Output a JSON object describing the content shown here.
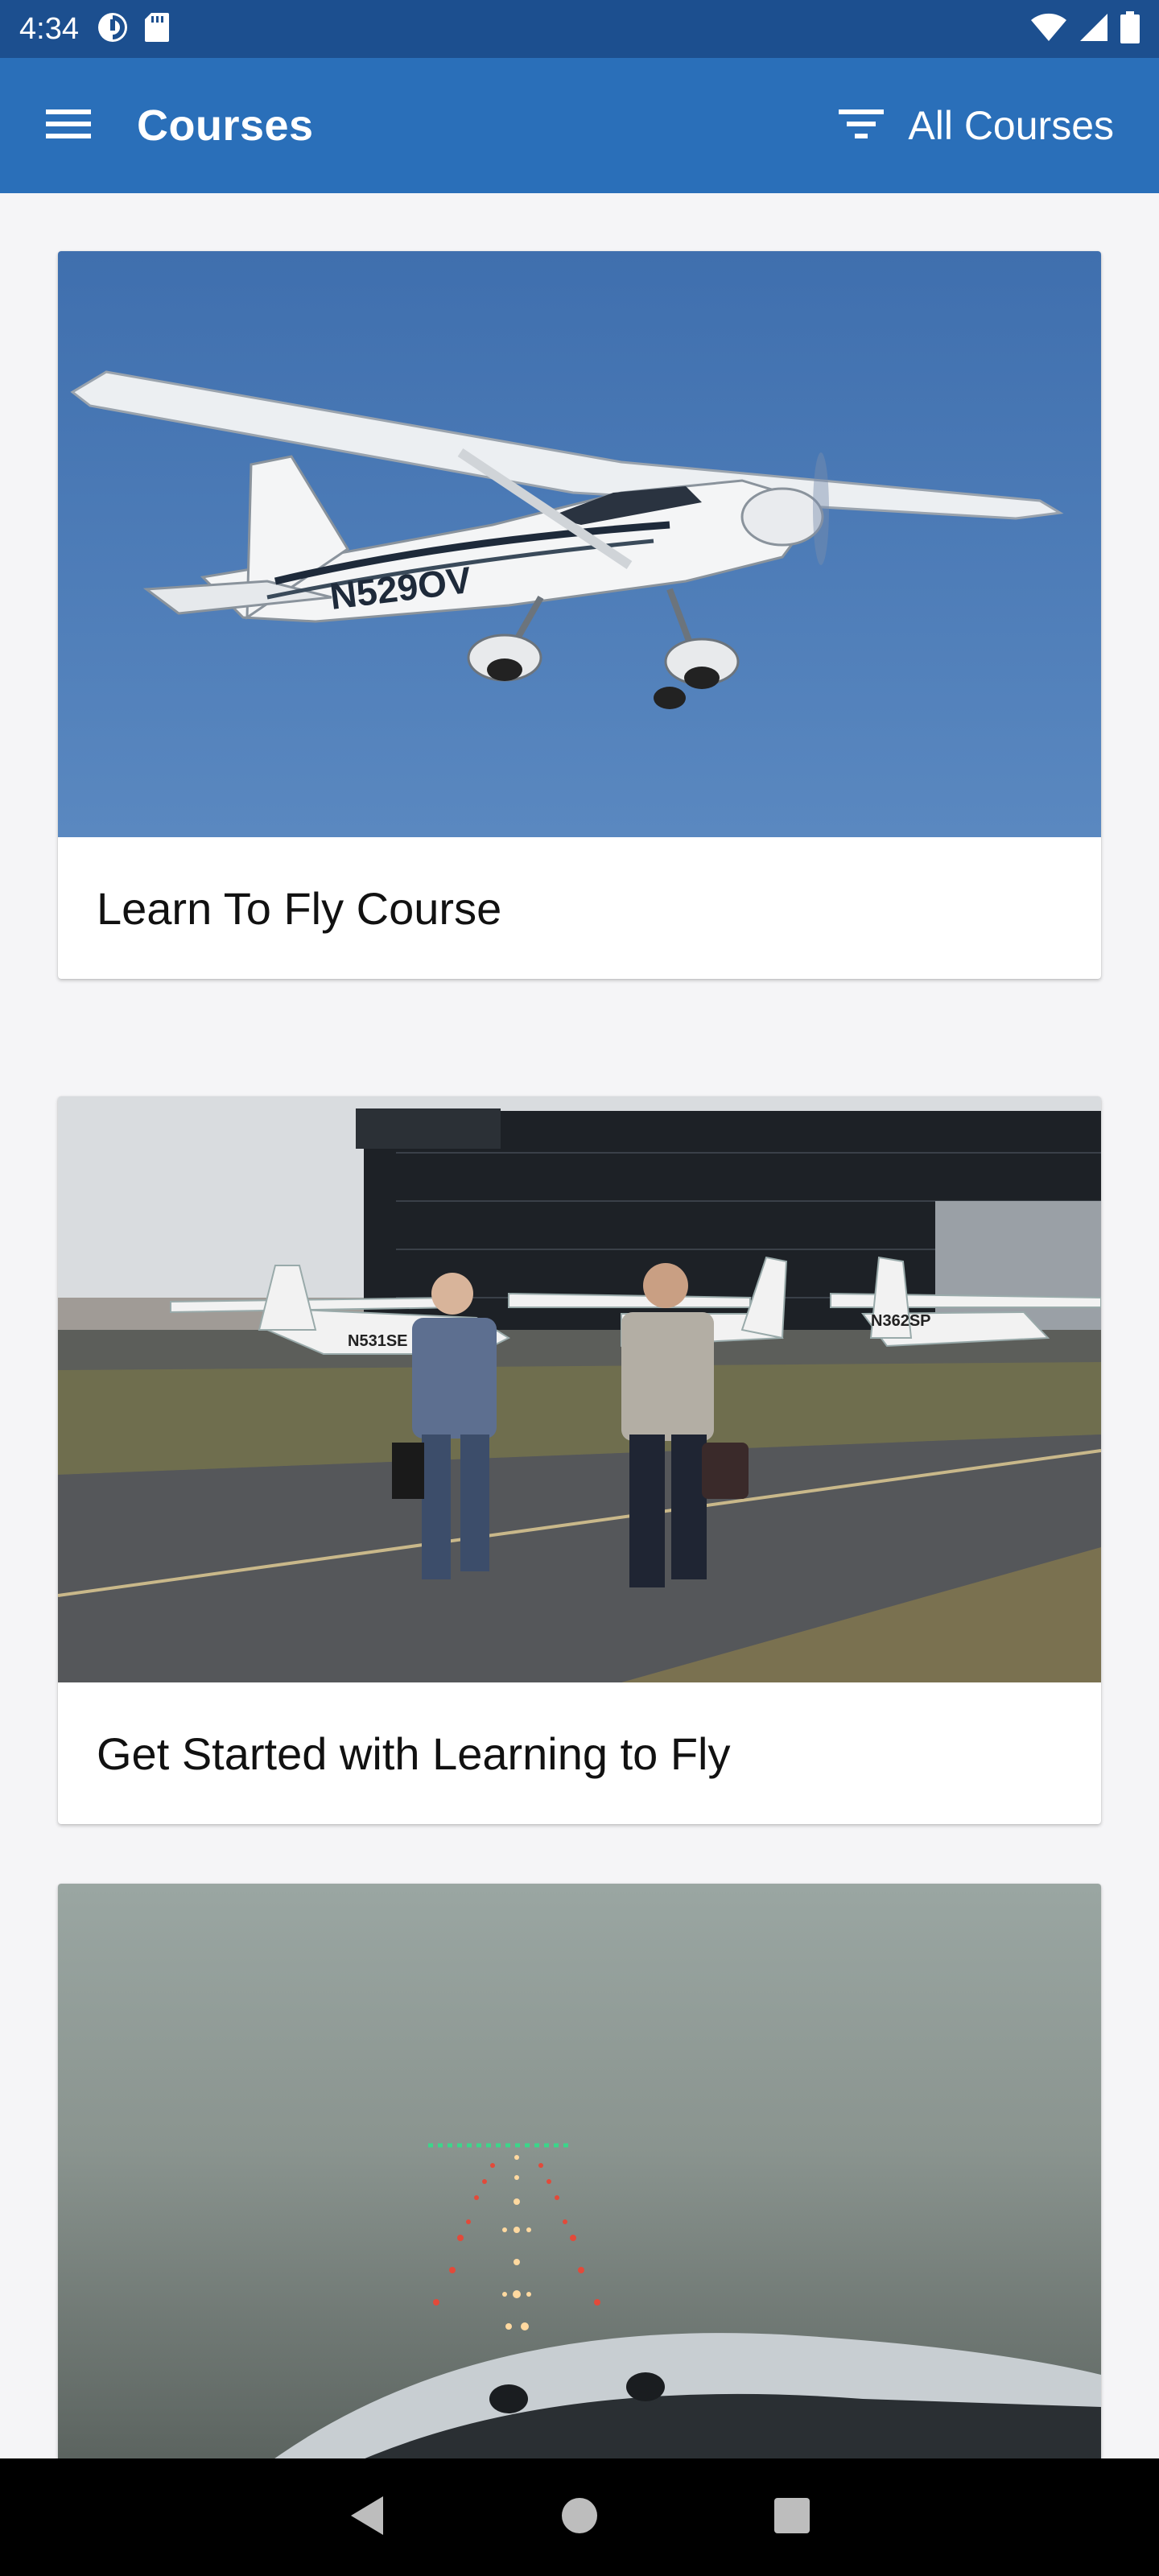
{
  "status_bar": {
    "time": "4:34",
    "left_icons": [
      "data-saver-icon",
      "sd-card-icon"
    ],
    "right_icons": [
      "wifi-icon",
      "signal-icon",
      "battery-icon"
    ]
  },
  "app_bar": {
    "title": "Courses",
    "menu_icon": "menu-icon",
    "filter_icon": "filter-icon",
    "filter_label": "All Courses",
    "color": "#2a6fb9"
  },
  "courses": [
    {
      "title": "Learn To Fly Course",
      "image": "cessna-in-flight",
      "aircraft_reg": "N529OV"
    },
    {
      "title": "Get Started with Learning to Fly",
      "image": "two-men-walking-on-ramp",
      "aircraft_regs": [
        "N531SE",
        "N362SP"
      ]
    },
    {
      "title": "",
      "image": "foggy-runway-approach"
    }
  ],
  "nav_bar": {
    "buttons": [
      "back-icon",
      "home-icon",
      "recents-icon"
    ]
  }
}
